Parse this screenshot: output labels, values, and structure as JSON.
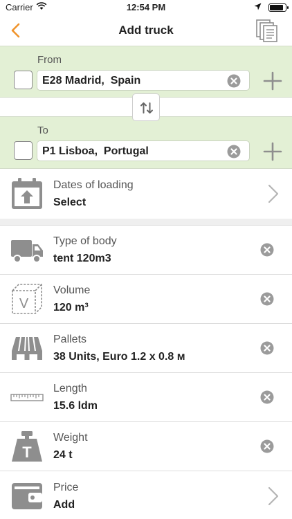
{
  "status_bar": {
    "carrier": "Carrier",
    "time": "12:54 PM",
    "battery_level": 0.9
  },
  "nav": {
    "title": "Add truck"
  },
  "from": {
    "label": "From",
    "value": "E28 Madrid,  Spain"
  },
  "to": {
    "label": "To",
    "value": "P1 Lisboa,  Portugal"
  },
  "rows": [
    {
      "label": "Dates of loading",
      "value": "Select",
      "icon": "calendar-upload-icon",
      "action": "chevron"
    },
    {
      "label": "Type of body",
      "value": "tent 120m3",
      "icon": "truck-icon",
      "action": "clear"
    },
    {
      "label": "Volume",
      "value": "120 m³",
      "icon": "volume-cube-icon",
      "icon_letter": "V",
      "action": "clear"
    },
    {
      "label": "Pallets",
      "value": "38 Units, Euro 1.2 x 0.8 м",
      "icon": "pallet-icon",
      "action": "clear"
    },
    {
      "label": "Length",
      "value": "15.6 ldm",
      "icon": "ruler-icon",
      "action": "clear"
    },
    {
      "label": "Weight",
      "value": "24 t",
      "icon": "weight-icon",
      "icon_letter": "T",
      "action": "clear"
    },
    {
      "label": "Price",
      "value": "Add",
      "icon": "wallet-icon",
      "action": "chevron"
    }
  ],
  "colors": {
    "accent": "#f0932b",
    "route_bg": "#e3f0d5",
    "icon_gray": "#8e8e8e",
    "clear_gray": "#9b9b9b"
  }
}
